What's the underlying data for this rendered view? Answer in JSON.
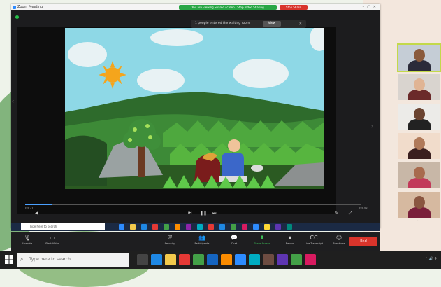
{
  "window": {
    "title": "Zoom Meeting",
    "share_banner": "You are viewing Shared screen · Stop Video Sharing",
    "stop_share": "Stop Share"
  },
  "waiting_room": {
    "message": "1 people entered the waiting room",
    "view_label": "View"
  },
  "video": {
    "time_elapsed": "00:21",
    "time_total": "00:48",
    "progress_fraction": 0.08
  },
  "inner_taskbar": {
    "search_placeholder": "Type here to search"
  },
  "toolbar": {
    "items": [
      {
        "label": "Unmute",
        "icon": "mic-icon"
      },
      {
        "label": "Start Video",
        "icon": "video-icon"
      },
      {
        "label": "Security",
        "icon": "shield-icon"
      },
      {
        "label": "Participants",
        "icon": "participants-icon"
      },
      {
        "label": "Chat",
        "icon": "chat-icon"
      },
      {
        "label": "Share Screen",
        "icon": "share-icon"
      },
      {
        "label": "Record",
        "icon": "record-icon"
      },
      {
        "label": "Live Transcript",
        "icon": "cc-icon"
      },
      {
        "label": "Reactions",
        "icon": "reaction-icon"
      }
    ],
    "end_label": "End"
  },
  "gallery": {
    "participants": [
      "",
      "",
      "",
      "",
      "",
      ""
    ],
    "active_index": 0
  },
  "taskbar": {
    "search_placeholder": "Type here to search"
  },
  "colors": {
    "zoom_blue": "#2d8cff",
    "share_green": "#28a745",
    "end_red": "#d9342b",
    "active_speaker": "#c3d94a"
  }
}
